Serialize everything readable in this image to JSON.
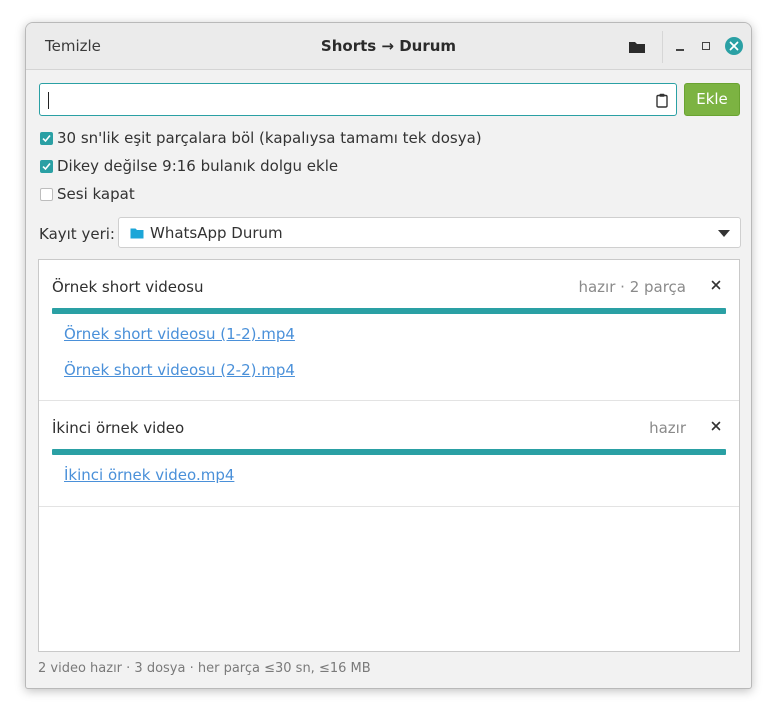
{
  "window": {
    "title": "Shorts → Durum",
    "clear_label": "Temizle"
  },
  "url_input": {
    "value": "",
    "placeholder": ""
  },
  "add_button": {
    "label": "Ekle"
  },
  "options": [
    {
      "label": "30 sn'lik eşit parçalara böl (kapalıysa tamamı tek dosya)",
      "checked": true
    },
    {
      "label": "Dikey değilse 9:16 bulanık dolgu ekle",
      "checked": true
    },
    {
      "label": "Sesi kapat",
      "checked": false
    }
  ],
  "save": {
    "label": "Kayıt yeri:",
    "value": "WhatsApp Durum"
  },
  "jobs": [
    {
      "title": "Örnek short videosu",
      "status": "hazır · 2 parça",
      "progress": 1.0,
      "files": [
        "Örnek short videosu (1-2).mp4",
        "Örnek short videosu (2-2).mp4"
      ]
    },
    {
      "title": "İkinci örnek video",
      "status": "hazır",
      "progress": 1.0,
      "files": [
        "İkinci örnek video.mp4"
      ]
    }
  ],
  "status_bar": "2 video hazır · 3 dosya · her parça ≤30 sn, ≤16 MB",
  "colors": {
    "accent": "#2aa0a4",
    "add_button": "#7cb342",
    "link": "#4a90d9",
    "folder": "#1ca6d8"
  },
  "icons": {
    "open_folder": "folder-icon",
    "paste": "clipboard-icon",
    "close": "close-icon",
    "remove": "x-icon"
  }
}
